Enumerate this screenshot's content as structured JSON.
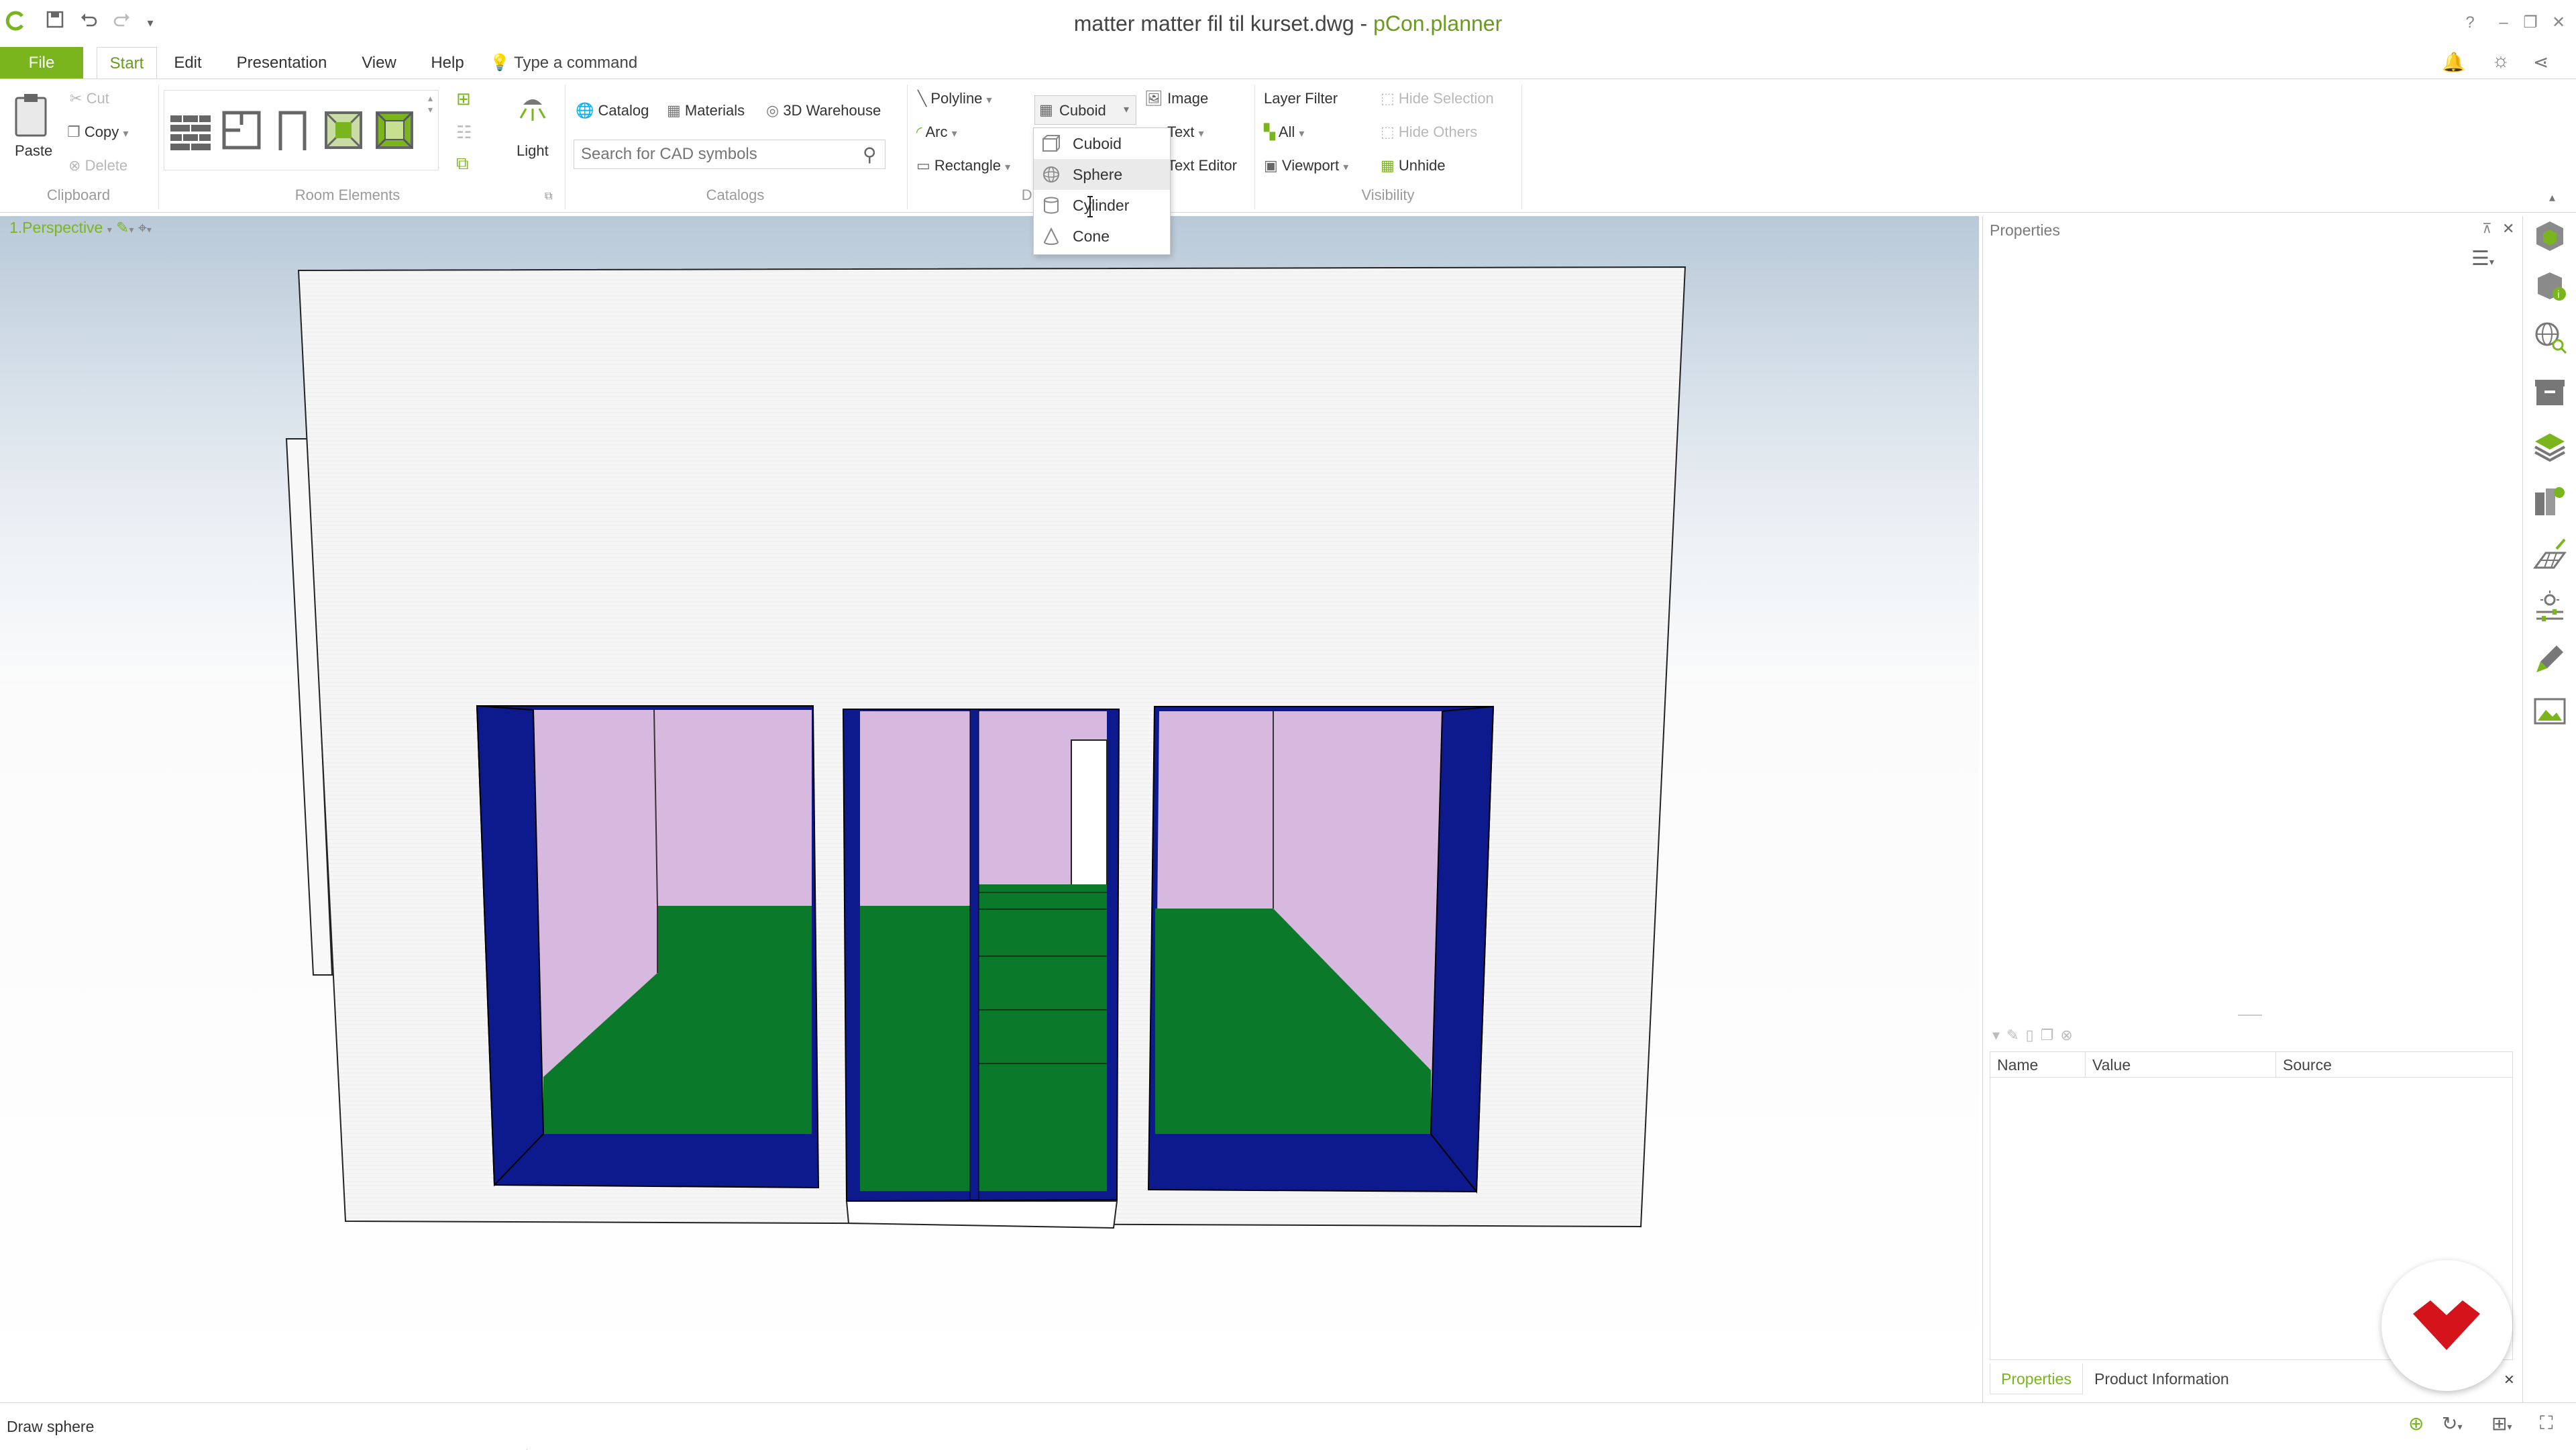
{
  "window": {
    "file_title": "matter matter fil til kurset.dwg",
    "separator": " - ",
    "app_name": "pCon.planner",
    "help": "?"
  },
  "menu": {
    "file": "File",
    "start": "Start",
    "edit": "Edit",
    "presentation": "Presentation",
    "view": "View",
    "help": "Help",
    "command": "Type a command"
  },
  "ribbon": {
    "clipboard": {
      "paste": "Paste",
      "cut": "Cut",
      "copy": "Copy",
      "delete": "Delete",
      "group": "Clipboard"
    },
    "room_elements": {
      "group": "Room Elements",
      "light": "Light"
    },
    "catalogs": {
      "catalog": "Catalog",
      "materials": "Materials",
      "warehouse": "3D Warehouse",
      "search_placeholder": "Search for CAD symbols",
      "group": "Catalogs"
    },
    "draw": {
      "polyline": "Polyline",
      "arc": "Arc",
      "rectangle": "Rectangle",
      "cuboid": "Cuboid",
      "group": "Dr"
    },
    "insert": {
      "image": "Image",
      "text": "Text",
      "text_editor": "Text Editor"
    },
    "layers": {
      "layer_filter": "Layer Filter",
      "all": "All",
      "viewport": "Viewport"
    },
    "visibility": {
      "hide_selection": "Hide Selection",
      "hide_others": "Hide Others",
      "unhide": "Unhide",
      "group": "Visibility"
    }
  },
  "dropdown": {
    "items": [
      "Cuboid",
      "Sphere",
      "Cylinder",
      "Cone"
    ],
    "highlighted": "Sphere"
  },
  "viewport": {
    "label": "1.Perspective"
  },
  "properties": {
    "title": "Properties",
    "columns": [
      "Name",
      "Value",
      "Source"
    ],
    "tabs": [
      "Properties",
      "Product Information"
    ]
  },
  "status": {
    "text": "Draw sphere"
  },
  "colors": {
    "accent": "#7ab51d",
    "frame_blue": "#0d1a8e",
    "floor_green": "#0a7a2a",
    "wall_lilac": "#d7b8de"
  }
}
